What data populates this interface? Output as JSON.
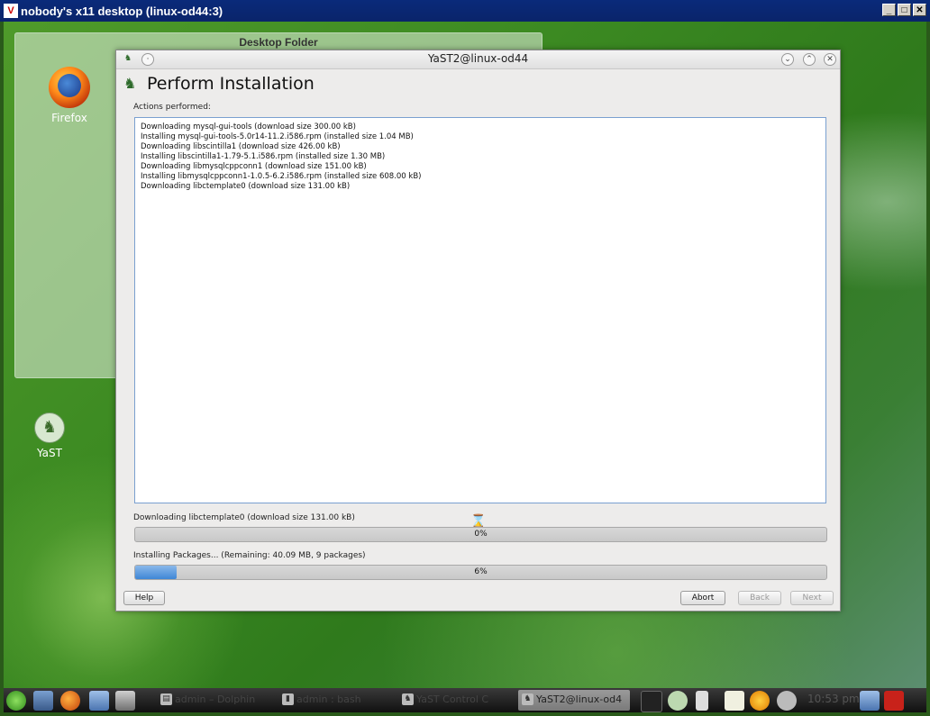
{
  "vnc": {
    "logo": "V",
    "title": "nobody's x11 desktop (linux-od44:3)",
    "minimize": "_",
    "maximize": "□",
    "close": "✕"
  },
  "desktop": {
    "folder_title": "Desktop Folder",
    "icons": [
      {
        "label": "Firefox",
        "icon": "firefox-icon"
      },
      {
        "label": "YaST",
        "icon": "yast-icon"
      }
    ]
  },
  "window": {
    "title": "YaST2@linux-od44",
    "heading": "Perform Installation",
    "actions_label": "Actions performed:",
    "log": [
      "Downloading mysql-gui-tools (download size 300.00 kB)",
      "Installing mysql-gui-tools-5.0r14-11.2.i586.rpm (installed size 1.04 MB)",
      "Downloading libscintilla1 (download size 426.00 kB)",
      "Installing libscintilla1-1.79-5.1.i586.rpm (installed size 1.30 MB)",
      "Downloading libmysqlcppconn1 (download size 151.00 kB)",
      "Installing libmysqlcppconn1-1.0.5-6.2.i586.rpm (installed size 608.00 kB)",
      "Downloading libctemplate0 (download size 131.00 kB)"
    ],
    "progress1": {
      "label": "Downloading libctemplate0 (download size 131.00 kB)",
      "text": "0%",
      "value": 0
    },
    "progress2": {
      "label": "Installing Packages... (Remaining: 40.09 MB, 9 packages)",
      "text": "6%",
      "value": 6
    },
    "buttons": {
      "help": "Help",
      "abort": "Abort",
      "back": "Back",
      "next": "Next"
    }
  },
  "taskbar": {
    "tasks": [
      {
        "label": "admin – Dolphin",
        "active": false
      },
      {
        "label": "admin : bash",
        "active": false
      },
      {
        "label": "YaST Control C",
        "active": false
      },
      {
        "label": "YaST2@linux-od4",
        "active": true
      }
    ],
    "clock": "10:53 pm"
  },
  "colors": {
    "accent": "#3f86d6",
    "desktop": "#3c8a22",
    "vnc_bar": "#0a246a"
  }
}
